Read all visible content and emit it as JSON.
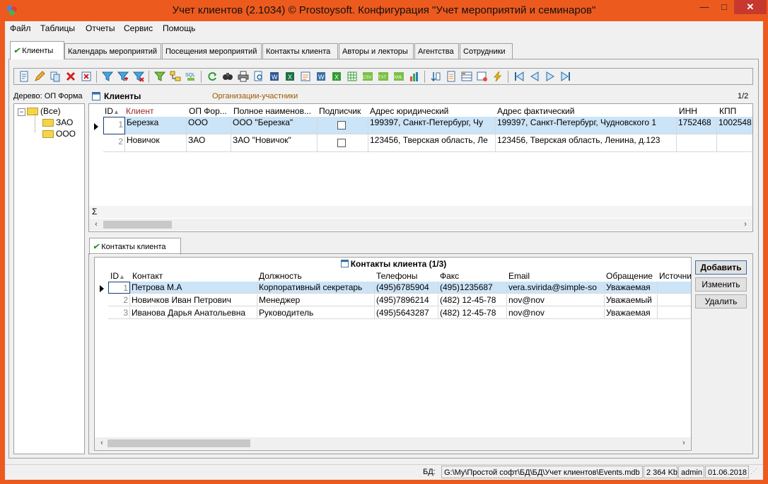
{
  "window": {
    "title": "Учет клиентов (2.1034) © Prostoysoft. Конфигурация \"Учет мероприятий и семинаров\"",
    "minimize": "—",
    "maximize": "□",
    "close": "✕"
  },
  "menu": [
    "Файл",
    "Таблицы",
    "Отчеты",
    "Сервис",
    "Помощь"
  ],
  "tabs": [
    {
      "label": "Клиенты",
      "active": true
    },
    {
      "label": "Календарь мероприятий",
      "active": false
    },
    {
      "label": "Посещения мероприятий",
      "active": false
    },
    {
      "label": "Контакты клиента",
      "active": false
    },
    {
      "label": "Авторы и лекторы",
      "active": false
    },
    {
      "label": "Агентства",
      "active": false
    },
    {
      "label": "Сотрудники",
      "active": false
    }
  ],
  "tree": {
    "label": "Дерево: ОП Форма",
    "root": "(Все)",
    "children": [
      "ЗАО",
      "ООО"
    ]
  },
  "clients": {
    "title": "Клиенты",
    "subtitle": "Организации-участники",
    "page": "1/2",
    "columns": [
      "ID",
      "Клиент",
      "ОП Фор...",
      "Полное наименов...",
      "Подписчик",
      "Адрес юридический",
      "Адрес фактический",
      "ИНН",
      "КПП"
    ],
    "rows": [
      {
        "id": "1",
        "client": "Березка",
        "form": "ООО",
        "fullname": "ООО \"Березка\"",
        "subscriber": false,
        "legal": "199397, Санкт-Петербург, Чу",
        "actual": "199397, Санкт-Петербург, Чудновского 1",
        "inn": "1752468",
        "kpp": "1002548"
      },
      {
        "id": "2",
        "client": "Новичок",
        "form": "ЗАО",
        "fullname": "ЗАО \"Новичок\"",
        "subscriber": false,
        "legal": "123456, Тверская область, Ле",
        "actual": "123456, Тверская область, Ленина, д.123",
        "inn": "",
        "kpp": ""
      }
    ],
    "sum_symbol": "Σ"
  },
  "contacts_tab": {
    "label": "Контакты клиента"
  },
  "contacts": {
    "title": "Контакты клиента (1/3)",
    "columns": [
      "ID",
      "Контакт",
      "Должность",
      "Телефоны",
      "Факс",
      "Email",
      "Обращение",
      "Источни"
    ],
    "rows": [
      {
        "id": "1",
        "name": "Петрова М.А",
        "position": "Корпоративный секретарь",
        "phone": "(495)6785904",
        "fax": "(495)1235687",
        "email": "vera.svirida@simple-so",
        "address": "Уважаемая"
      },
      {
        "id": "2",
        "name": "Новичков Иван Петрович",
        "position": "Менеджер",
        "phone": "(495)7896214",
        "fax": "(482) 12-45-78",
        "email": "nov@nov",
        "address": "Уважаемый"
      },
      {
        "id": "3",
        "name": "Иванова Дарья Анатольевна",
        "position": "Руководитель",
        "phone": "(495)5643287",
        "fax": "(482) 12-45-78",
        "email": "nov@nov",
        "address": "Уважаемая"
      }
    ],
    "buttons": {
      "add": "Добавить",
      "edit": "Изменить",
      "delete": "Удалить"
    }
  },
  "status": {
    "db_label": "БД:",
    "db_path": "G:\\Мy\\Простой софт\\БД\\БД\\Учет клиентов\\Events.mdb",
    "size": "2 364 Kb",
    "user": "admin",
    "date": "01.06.2018"
  },
  "colors": {
    "frame": "#ed5a1e",
    "selection": "#cce4f7",
    "close": "#c7392f"
  }
}
